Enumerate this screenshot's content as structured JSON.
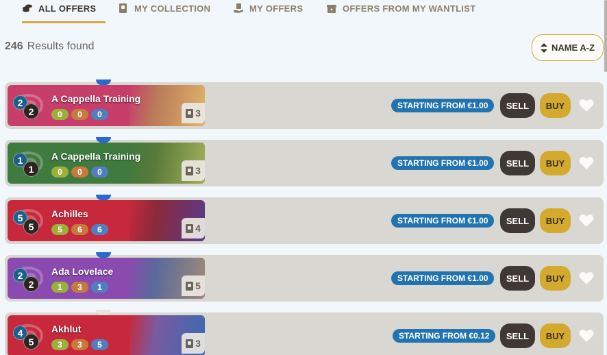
{
  "tabs": [
    {
      "label": "ALL OFFERS",
      "icon": "coins-icon",
      "active": true
    },
    {
      "label": "MY COLLECTION",
      "icon": "collection-icon",
      "active": false
    },
    {
      "label": "MY OFFERS",
      "icon": "hand-offer-icon",
      "active": false
    },
    {
      "label": "OFFERS FROM MY WANTLIST",
      "icon": "wantlist-box-icon",
      "active": false
    }
  ],
  "results": {
    "count": "246",
    "label": "Results found"
  },
  "sort": {
    "label": "NAME A-Z",
    "icon": "sort-updown-icon"
  },
  "colors": {
    "accent": "#d4a93a",
    "price": "#2274b0",
    "sell": "#3f3834",
    "buy": "#d4aa2e"
  },
  "offers": [
    {
      "name": "A Cappella Training",
      "cost_top": "2",
      "cost_bottom": "2",
      "stats": [
        "0",
        "0",
        "0"
      ],
      "count": "3",
      "price": "STARTING FROM €1.00",
      "sell": "SELL",
      "buy": "BUY",
      "card_color": "#c73e6a"
    },
    {
      "name": "A Cappella Training",
      "cost_top": "1",
      "cost_bottom": "1",
      "stats": [
        "0",
        "0",
        "0"
      ],
      "count": "3",
      "price": "STARTING FROM €1.00",
      "sell": "SELL",
      "buy": "BUY",
      "card_color": "#3f7a3f"
    },
    {
      "name": "Achilles",
      "cost_top": "5",
      "cost_bottom": "5",
      "stats": [
        "5",
        "6",
        "6"
      ],
      "count": "4",
      "price": "STARTING FROM €1.00",
      "sell": "SELL",
      "buy": "BUY",
      "card_color": "#c8283c"
    },
    {
      "name": "Ada Lovelace",
      "cost_top": "2",
      "cost_bottom": "2",
      "stats": [
        "1",
        "3",
        "1"
      ],
      "count": "5",
      "price": "STARTING FROM €1.00",
      "sell": "SELL",
      "buy": "BUY",
      "card_color": "#8a4ab0"
    },
    {
      "name": "Akhlut",
      "cost_top": "4",
      "cost_bottom": "5",
      "stats": [
        "3",
        "3",
        "5"
      ],
      "count": "3",
      "price": "STARTING FROM €0.12",
      "sell": "SELL",
      "buy": "BUY",
      "card_color": "#c8283c"
    }
  ]
}
